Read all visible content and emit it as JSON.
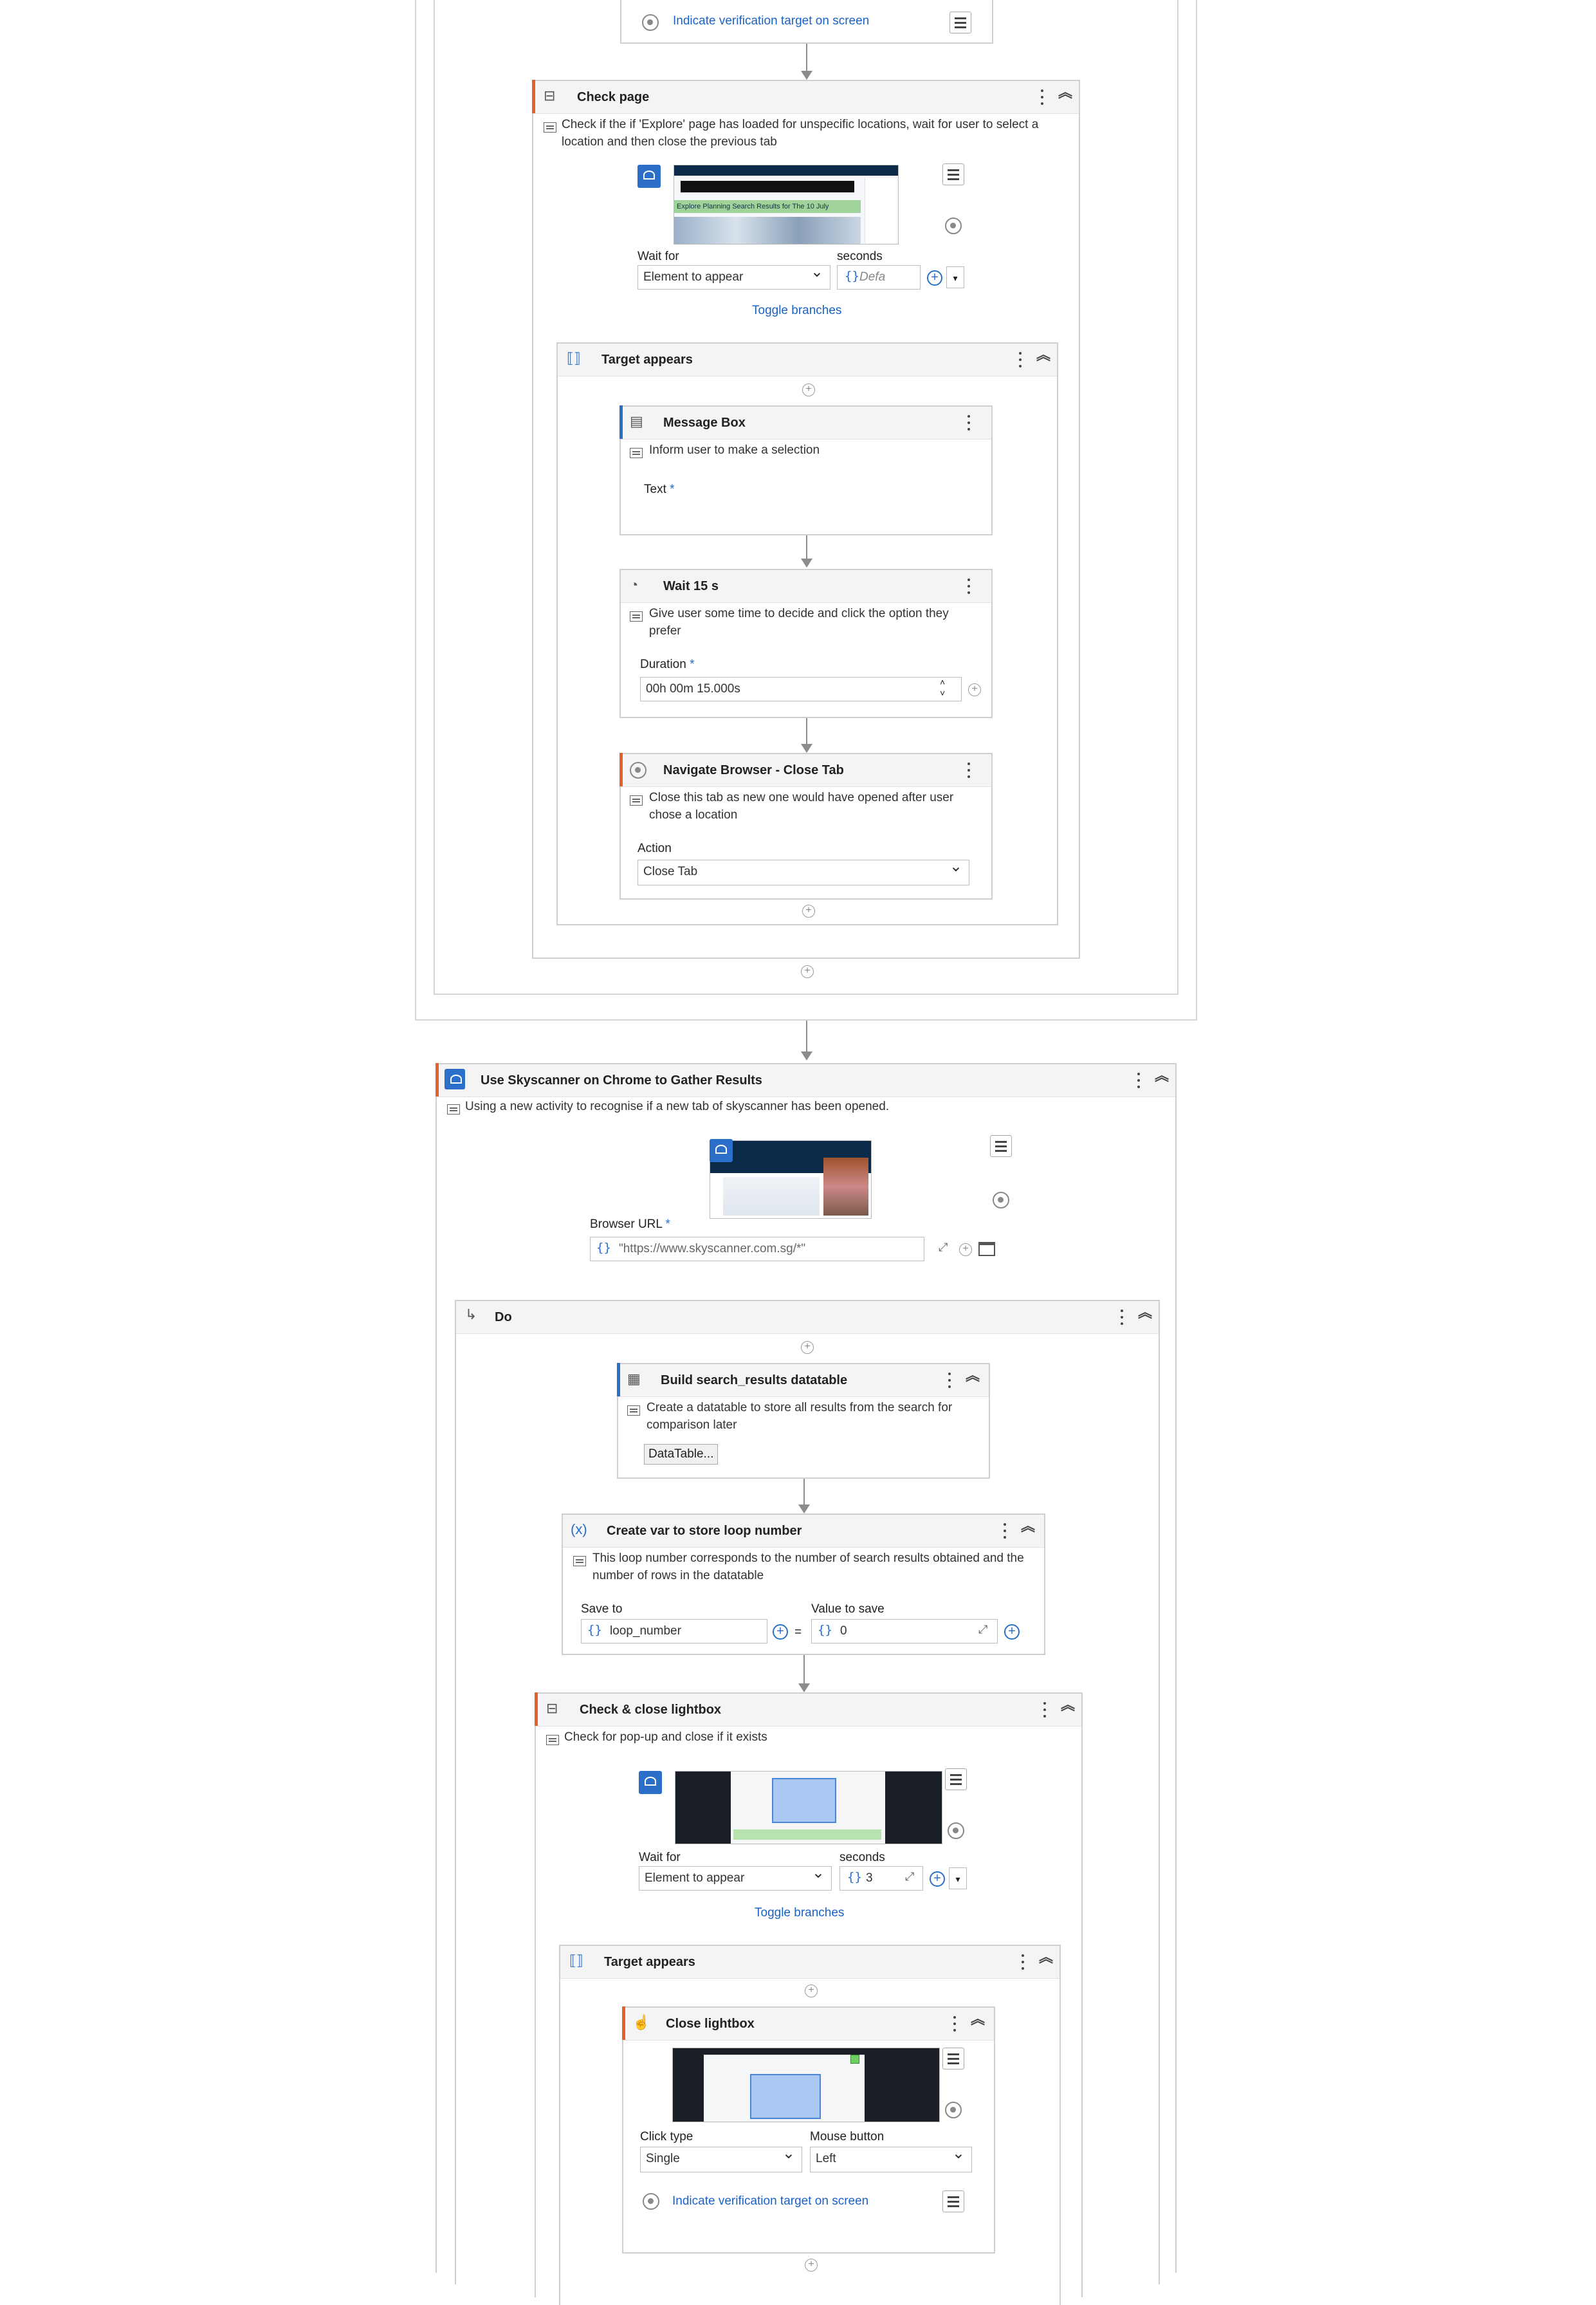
{
  "top_partial": {
    "verify_link": "Indicate verification target on screen"
  },
  "check_page": {
    "title": "Check page",
    "description": "Check if the if 'Explore' page has loaded for unspecific locations, wait for user to select a location and then close the previous tab",
    "wait_for_label": "Wait for",
    "wait_for_value": "Element to appear",
    "seconds_label": "seconds",
    "seconds_value": "Defa",
    "toggle_branches": "Toggle branches",
    "screenshot_banner": "Explore Planning Search Results for The 10 July"
  },
  "target_appears_1": {
    "title": "Target appears",
    "message_box": {
      "title": "Message Box",
      "description": "Inform user to make a selection",
      "text_label": "Text"
    },
    "wait": {
      "title": "Wait 15 s",
      "description": "Give user some time to decide and click the option they prefer",
      "duration_label": "Duration",
      "duration_value": "00h 00m 15.000s"
    },
    "navigate": {
      "title": "Navigate Browser - Close Tab",
      "description": "Close this tab as new one would have opened after user chose a location",
      "action_label": "Action",
      "action_value": "Close Tab"
    }
  },
  "use_skyscanner": {
    "title": "Use Skyscanner on Chrome to Gather Results",
    "description": "Using a new activity to recognise if a new tab of skyscanner has been opened.",
    "browser_url_label": "Browser URL",
    "browser_url_value": "\"https://www.skyscanner.com.sg/*\""
  },
  "do_block": {
    "title": "Do",
    "build_dt": {
      "title": "Build search_results datatable",
      "description": "Create a datatable to store all results from the search for comparison later",
      "button": "DataTable..."
    },
    "create_var": {
      "title": "Create var to store loop number",
      "description": "This loop number corresponds to the number of search results obtained and the number of rows in the datatable",
      "save_to_label": "Save to",
      "save_to_value": "loop_number",
      "value_label": "Value to save",
      "value_value": "0",
      "equals": "="
    },
    "check_lightbox": {
      "title": "Check & close lightbox",
      "description": "Check for pop-up and close if it exists",
      "wait_for_label": "Wait for",
      "wait_for_value": "Element to appear",
      "seconds_label": "seconds",
      "seconds_value": "3",
      "toggle_branches": "Toggle branches"
    },
    "target_appears_2": {
      "title": "Target appears",
      "close_lightbox": {
        "title": "Close lightbox",
        "click_type_label": "Click type",
        "click_type_value": "Single",
        "mouse_button_label": "Mouse button",
        "mouse_button_value": "Left",
        "verify_link": "Indicate verification target on screen"
      }
    }
  },
  "colors": {
    "accent": "#e2622c",
    "link": "#1a62c6",
    "border": "#cfcfcf"
  }
}
